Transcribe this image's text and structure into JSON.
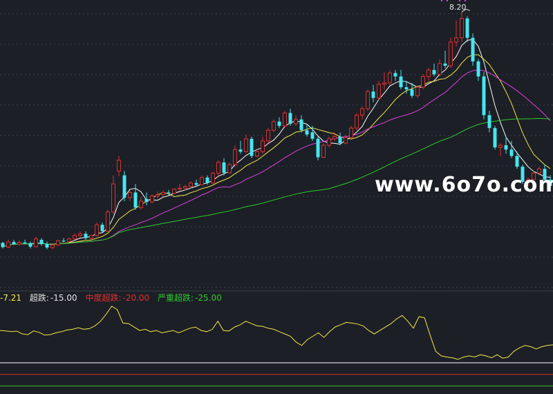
{
  "colors": {
    "background": "#1c1f26",
    "grid": "#3a3f4a",
    "up": "#e0302f",
    "down": "#45e6f0",
    "ma5": "#ffffff",
    "ma10": "#f5e84a",
    "ma20": "#e040e0",
    "ma60": "#2ecc2e",
    "osc": "#f5e84a",
    "level_white": "#ffffff",
    "level_red": "#e0302f",
    "level_green": "#2ecc2e"
  },
  "legend": {
    "value": "-7.21",
    "level1_label": "超跌:",
    "level1_value": "-15.00",
    "level2_label": "中度超跌:",
    "level2_value": "-20.00",
    "level3_label": "严重超跌:",
    "level3_value": "-25.00"
  },
  "peak_label": "8.20",
  "watermark": "www.6o7o.com",
  "chart_data": {
    "type": "candlestick",
    "candles": [
      [
        2.83,
        2.85,
        2.7,
        2.73
      ],
      [
        2.73,
        2.9,
        2.7,
        2.85
      ],
      [
        2.85,
        2.9,
        2.78,
        2.8
      ],
      [
        2.8,
        2.88,
        2.76,
        2.84
      ],
      [
        2.84,
        2.9,
        2.8,
        2.82
      ],
      [
        2.82,
        2.86,
        2.7,
        2.74
      ],
      [
        2.74,
        2.97,
        2.72,
        2.92
      ],
      [
        2.9,
        2.94,
        2.76,
        2.8
      ],
      [
        2.8,
        2.86,
        2.68,
        2.72
      ],
      [
        2.72,
        2.8,
        2.68,
        2.78
      ],
      [
        2.78,
        2.9,
        2.76,
        2.88
      ],
      [
        2.88,
        2.94,
        2.84,
        2.86
      ],
      [
        2.86,
        2.95,
        2.84,
        2.92
      ],
      [
        2.92,
        3.05,
        2.9,
        3.0
      ],
      [
        3.0,
        3.1,
        2.96,
        3.04
      ],
      [
        3.04,
        3.1,
        2.9,
        2.94
      ],
      [
        2.94,
        3.02,
        2.9,
        3.0
      ],
      [
        3.0,
        3.3,
        2.98,
        3.25
      ],
      [
        3.25,
        3.3,
        3.05,
        3.1
      ],
      [
        3.1,
        3.6,
        3.08,
        3.55
      ],
      [
        3.55,
        4.4,
        3.5,
        4.2
      ],
      [
        4.5,
        4.85,
        4.38,
        4.75
      ],
      [
        4.4,
        4.5,
        3.8,
        3.88
      ],
      [
        3.88,
        4.05,
        3.8,
        4.0
      ],
      [
        4.0,
        4.2,
        3.6,
        3.65
      ],
      [
        3.65,
        3.9,
        3.6,
        3.8
      ],
      [
        3.85,
        4.0,
        3.7,
        3.78
      ],
      [
        3.78,
        3.96,
        3.74,
        3.92
      ],
      [
        3.92,
        4.02,
        3.86,
        3.95
      ],
      [
        3.95,
        4.05,
        3.9,
        4.0
      ],
      [
        4.0,
        4.06,
        3.94,
        3.98
      ],
      [
        3.98,
        4.1,
        3.96,
        4.08
      ],
      [
        4.08,
        4.2,
        4.04,
        4.1
      ],
      [
        4.1,
        4.18,
        4.04,
        4.14
      ],
      [
        4.14,
        4.26,
        4.1,
        4.22
      ],
      [
        4.22,
        4.3,
        4.14,
        4.18
      ],
      [
        4.18,
        4.4,
        4.16,
        4.35
      ],
      [
        4.35,
        4.4,
        4.18,
        4.22
      ],
      [
        4.22,
        4.48,
        4.2,
        4.45
      ],
      [
        4.45,
        4.75,
        4.4,
        4.7
      ],
      [
        4.7,
        4.8,
        4.4,
        4.46
      ],
      [
        4.46,
        4.7,
        4.44,
        4.65
      ],
      [
        4.65,
        5.1,
        4.6,
        5.0
      ],
      [
        5.0,
        5.2,
        4.9,
        4.95
      ],
      [
        4.95,
        5.35,
        4.92,
        5.25
      ],
      [
        5.25,
        5.3,
        4.8,
        4.85
      ],
      [
        4.85,
        5.0,
        4.82,
        4.95
      ],
      [
        4.95,
        5.3,
        4.9,
        5.2
      ],
      [
        5.2,
        5.5,
        5.15,
        5.45
      ],
      [
        5.45,
        5.7,
        5.4,
        5.65
      ],
      [
        5.65,
        5.75,
        5.5,
        5.55
      ],
      [
        5.55,
        5.9,
        5.5,
        5.85
      ],
      [
        5.85,
        5.95,
        5.55,
        5.6
      ],
      [
        5.6,
        5.8,
        5.55,
        5.7
      ],
      [
        5.7,
        5.8,
        5.4,
        5.45
      ],
      [
        5.45,
        5.6,
        5.3,
        5.35
      ],
      [
        5.4,
        5.55,
        5.2,
        5.25
      ],
      [
        5.25,
        5.3,
        4.75,
        4.82
      ],
      [
        4.82,
        5.15,
        4.8,
        5.1
      ],
      [
        5.1,
        5.3,
        5.05,
        5.25
      ],
      [
        5.25,
        5.4,
        5.2,
        5.3
      ],
      [
        5.3,
        5.4,
        5.1,
        5.15
      ],
      [
        5.15,
        5.35,
        5.12,
        5.28
      ],
      [
        5.28,
        5.55,
        5.25,
        5.5
      ],
      [
        5.5,
        5.85,
        5.45,
        5.8
      ],
      [
        5.8,
        6.0,
        5.7,
        5.95
      ],
      [
        5.95,
        6.4,
        5.9,
        6.35
      ],
      [
        6.35,
        6.5,
        6.1,
        6.2
      ],
      [
        6.2,
        6.6,
        6.15,
        6.52
      ],
      [
        6.52,
        6.8,
        6.4,
        6.55
      ],
      [
        6.55,
        6.85,
        6.5,
        6.78
      ],
      [
        6.78,
        6.85,
        6.6,
        6.7
      ],
      [
        6.7,
        6.85,
        6.4,
        6.45
      ],
      [
        6.45,
        6.6,
        6.3,
        6.4
      ],
      [
        6.4,
        6.55,
        6.2,
        6.25
      ],
      [
        6.25,
        6.5,
        6.2,
        6.45
      ],
      [
        6.45,
        6.75,
        6.4,
        6.7
      ],
      [
        6.7,
        6.9,
        6.6,
        6.85
      ],
      [
        6.85,
        7.0,
        6.7,
        6.75
      ],
      [
        6.75,
        7.1,
        6.7,
        7.0
      ],
      [
        7.0,
        7.3,
        6.9,
        6.95
      ],
      [
        6.95,
        7.6,
        6.9,
        7.5
      ],
      [
        7.5,
        8.0,
        7.4,
        7.6
      ],
      [
        7.6,
        8.2,
        7.5,
        8.05
      ],
      [
        8.05,
        8.1,
        7.5,
        7.6
      ],
      [
        7.6,
        7.7,
        6.95,
        7.05
      ],
      [
        7.05,
        7.1,
        6.6,
        6.7
      ],
      [
        6.7,
        6.8,
        5.7,
        5.8
      ],
      [
        5.8,
        5.9,
        5.4,
        5.5
      ],
      [
        5.5,
        5.55,
        5.0,
        5.05
      ],
      [
        5.05,
        5.15,
        4.85,
        5.1
      ],
      [
        5.1,
        5.3,
        4.9,
        5.0
      ],
      [
        5.0,
        5.2,
        4.8,
        4.85
      ],
      [
        4.85,
        4.95,
        4.55,
        4.6
      ],
      [
        4.6,
        4.65,
        4.2,
        4.25
      ],
      [
        4.25,
        4.35,
        4.15,
        4.3
      ],
      [
        4.3,
        4.5,
        4.25,
        4.45
      ],
      [
        4.45,
        4.6,
        4.4,
        4.55
      ],
      [
        4.55,
        4.65,
        4.25,
        4.3
      ],
      [
        4.3,
        4.4,
        4.1,
        4.15
      ]
    ],
    "peak_high": 8.2,
    "moving_averages": [
      "MA5",
      "MA10",
      "MA20",
      "MA60"
    ],
    "ylim": [
      2.4,
      8.35
    ],
    "grid": true,
    "indicator": {
      "current_value": -7.21,
      "levels": [
        -15.0,
        -20.0,
        -25.0
      ],
      "ylim": [
        -25.5,
        11
      ],
      "values": [
        -1.0,
        -1.2,
        -1.5,
        -1.3,
        -2.5,
        -2.8,
        -1.2,
        -1.8,
        -3.0,
        -2.8,
        -2.0,
        -1.5,
        -0.8,
        -0.5,
        0.2,
        -0.5,
        -0.2,
        1.0,
        3.0,
        6.0,
        9.5,
        8.0,
        2.2,
        2.0,
        0.5,
        -1.0,
        -0.5,
        -1.5,
        -1.0,
        -2.0,
        -1.5,
        -1.0,
        -2.0,
        -1.0,
        0.0,
        0.5,
        -1.0,
        -1.5,
        -0.5,
        3.0,
        -1.0,
        -1.2,
        0.5,
        1.5,
        3.0,
        2.0,
        1.0,
        0.8,
        0.0,
        -0.5,
        -1.5,
        -2.5,
        -3.5,
        -6.0,
        -7.5,
        -5.0,
        -3.5,
        -2.0,
        -4.0,
        -1.5,
        0.5,
        1.5,
        2.5,
        2.2,
        1.8,
        1.0,
        -1.0,
        -2.5,
        -1.0,
        0.5,
        2.0,
        4.0,
        5.5,
        3.0,
        0.0,
        5.0,
        4.5,
        -3.0,
        -10.0,
        -12.0,
        -12.5,
        -12.8,
        -13.5,
        -12.5,
        -12.0,
        -12.5,
        -11.5,
        -12.0,
        -12.8,
        -11.5,
        -13.0,
        -12.5,
        -10.0,
        -8.5,
        -7.5,
        -8.0,
        -9.0,
        -8.0,
        -7.5,
        -7.21
      ]
    }
  }
}
